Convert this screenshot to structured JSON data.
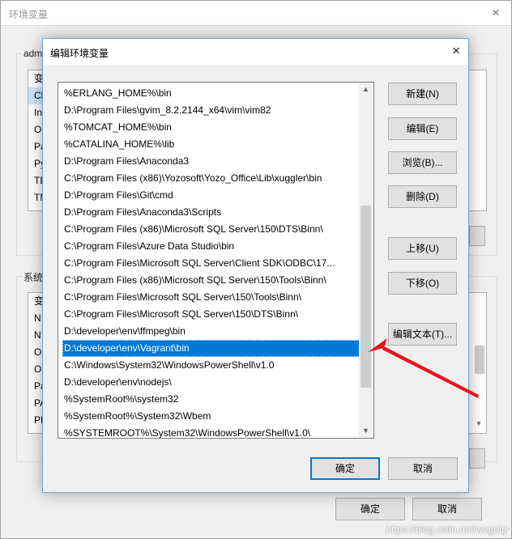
{
  "background_window": {
    "title": "环境变量",
    "user_group_label": "adm",
    "user_list_rows": [
      "变",
      "Ch",
      "In",
      "O",
      "Pa",
      "Py",
      "TE",
      "TM"
    ],
    "system_group_label": "系统",
    "system_list_rows": [
      "变",
      "N",
      "N",
      "O",
      "OS",
      "Pa",
      "PA",
      "PR"
    ],
    "ok_label": "确定",
    "cancel_label": "取消",
    "close_icon": "×"
  },
  "dialog": {
    "title": "编辑环境变量",
    "close_icon": "×",
    "selected_index": 16,
    "paths": [
      "%ERLANG_HOME%\\bin",
      "D:\\Program Files\\gvim_8.2.2144_x64\\vim\\vim82",
      "%TOMCAT_HOME%\\bin",
      "%CATALINA_HOME%\\lib",
      "D:\\Program Files\\Anaconda3",
      "C:\\Program Files (x86)\\Yozosoft\\Yozo_Office\\Lib\\xuggler\\bin",
      "D:\\Program Files\\Git\\cmd",
      "D:\\Program Files\\Anaconda3\\Scripts",
      "C:\\Program Files (x86)\\Microsoft SQL Server\\150\\DTS\\Binn\\",
      "C:\\Program Files\\Azure Data Studio\\bin",
      "C:\\Program Files\\Microsoft SQL Server\\Client SDK\\ODBC\\17...",
      "C:\\Program Files (x86)\\Microsoft SQL Server\\150\\Tools\\Binn\\",
      "C:\\Program Files\\Microsoft SQL Server\\150\\Tools\\Binn\\",
      "C:\\Program Files\\Microsoft SQL Server\\150\\DTS\\Binn\\",
      "D:\\developer\\env\\ffmpeg\\bin",
      "D:\\developer\\env\\Vagrant\\bin",
      "C:\\Windows\\System32\\WindowsPowerShell\\v1.0",
      "D:\\developer\\env\\nodejs\\",
      "%SystemRoot%\\system32",
      "%SystemRoot%\\System32\\Wbem",
      "%SYSTEMROOT%\\System32\\WindowsPowerShell\\v1.0\\"
    ],
    "buttons": {
      "new": "新建(N)",
      "edit": "编辑(E)",
      "browse": "浏览(B)...",
      "delete": "删除(D)",
      "move_up": "上移(U)",
      "move_down": "下移(O)",
      "edit_text": "编辑文本(T)...",
      "ok": "确定",
      "cancel": "取消"
    },
    "scroll_up_icon": "▲",
    "scroll_down_icon": "▼"
  },
  "annotation": {
    "color": "#e8131b",
    "points_to": "D:\\developer\\env\\Vagrant\\bin"
  },
  "watermark": "https://blog.csdn.net/wegofu",
  "colors": {
    "selection": "#0078d7",
    "dialog_bg": "#f0f0f0",
    "button_bg": "#e1e1e1"
  }
}
